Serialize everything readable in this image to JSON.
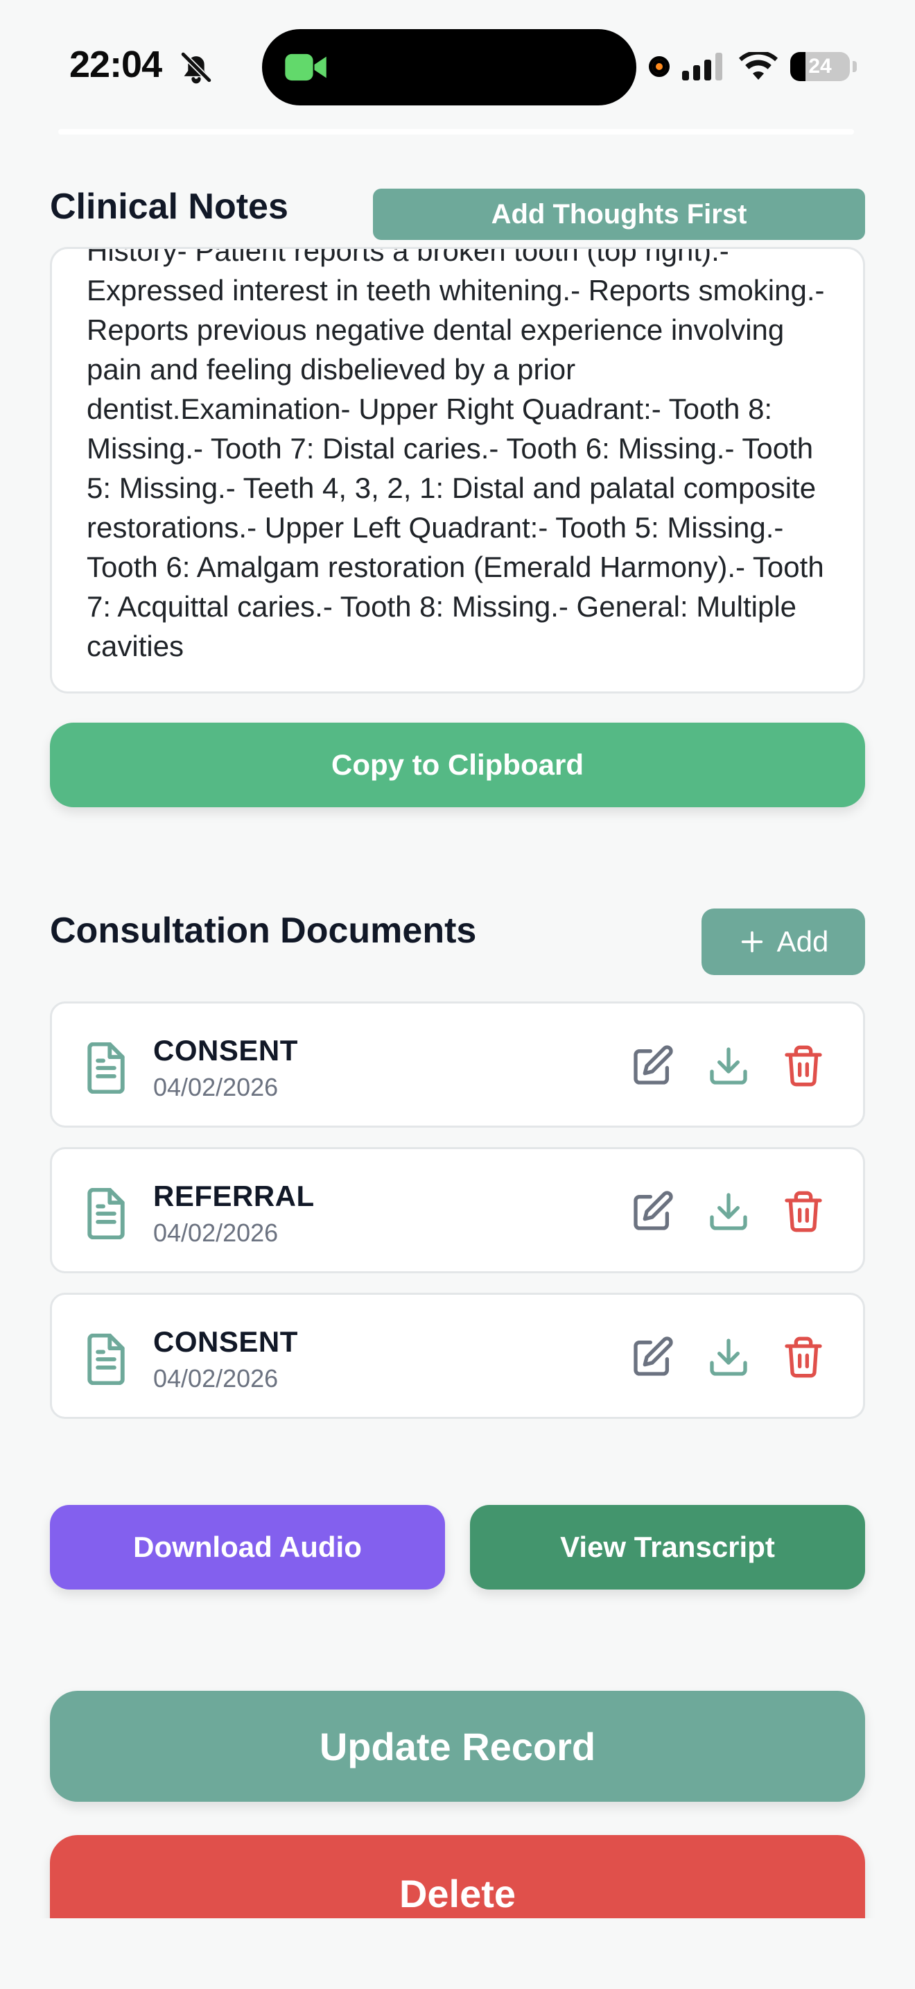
{
  "status_bar": {
    "time": "22:04",
    "battery": "24",
    "icons": [
      "bell-slash-icon",
      "facetime-camera-icon",
      "recording-dot-icon",
      "cellular-signal-icon",
      "wifi-icon",
      "battery-icon"
    ]
  },
  "clinical_notes": {
    "title": "Clinical Notes",
    "add_thoughts_label": "Add Thoughts First",
    "text": "History- Patient reports a broken tooth (top right).- Expressed interest in teeth whitening.- Reports smoking.- Reports previous negative dental experience involving pain and feeling disbelieved by a prior dentist.Examination- Upper Right Quadrant:- Tooth 8: Missing.- Tooth 7: Distal caries.- Tooth 6: Missing.- Tooth 5: Missing.- Teeth 4, 3, 2, 1: Distal and palatal composite restorations.- Upper Left Quadrant:- Tooth 5: Missing.- Tooth 6: Amalgam restoration (Emerald Harmony).- Tooth 7: Acquittal caries.- Tooth 8: Missing.- General: Multiple cavities",
    "copy_label": "Copy to Clipboard"
  },
  "documents": {
    "title": "Consultation Documents",
    "add_label": "Add",
    "items": [
      {
        "name": "CONSENT",
        "date": "04/02/2026"
      },
      {
        "name": "REFERRAL",
        "date": "04/02/2026"
      },
      {
        "name": "CONSENT",
        "date": "04/02/2026"
      }
    ]
  },
  "actions": {
    "download_audio": "Download Audio",
    "view_transcript": "View Transcript",
    "update_record": "Update Record",
    "delete": "Delete"
  },
  "colors": {
    "primary_teal": "#6ea99a",
    "copy_green": "#55b985",
    "audio_purple": "#8360ee",
    "transcript_green": "#43956d",
    "delete_red": "#e0504b"
  }
}
